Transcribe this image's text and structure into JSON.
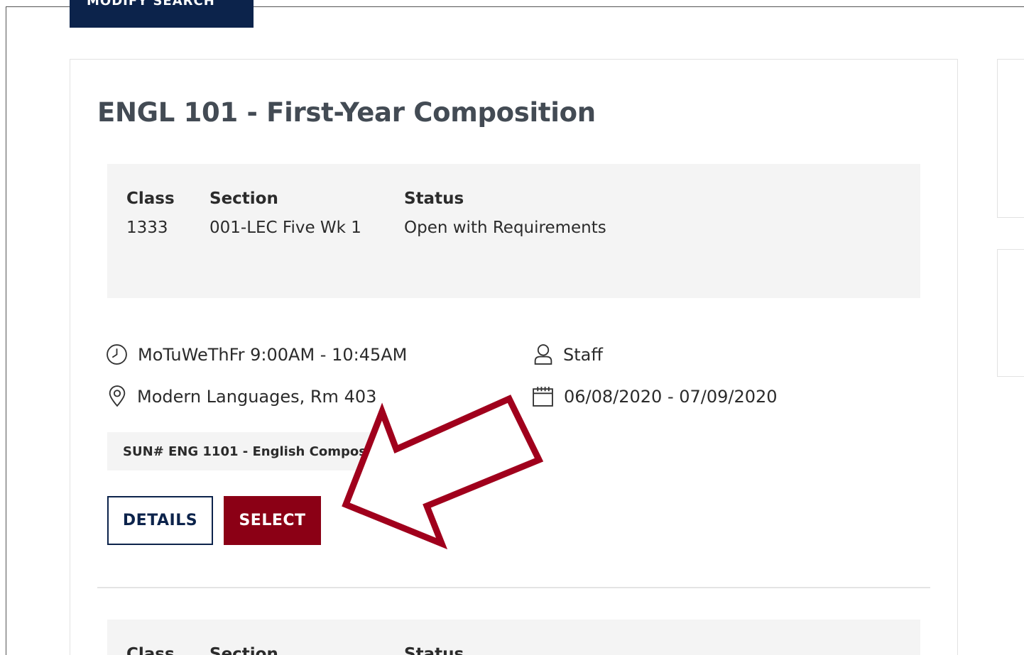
{
  "modify_search": {
    "label": "MODIFY SEARCH"
  },
  "course": {
    "title": "ENGL 101 - First-Year Composition"
  },
  "section1": {
    "headers": {
      "class": "Class",
      "section": "Section",
      "status": "Status"
    },
    "values": {
      "class": "1333",
      "section": "001-LEC Five Wk 1",
      "status": "Open with Requirements"
    }
  },
  "meeting": {
    "days_time": "MoTuWeThFr 9:00AM - 10:45AM",
    "instructor": "Staff",
    "location": "Modern Languages, Rm 403",
    "dates": "06/08/2020 - 07/09/2020"
  },
  "tag": {
    "text": "SUN# ENG 1101 - English Composition I"
  },
  "buttons": {
    "details": "DETAILS",
    "select": "SELECT"
  },
  "section2": {
    "headers": {
      "class": "Class",
      "section": "Section",
      "status": "Status"
    }
  },
  "icons": {
    "clock": "clock-icon",
    "location": "map-pin-icon",
    "person": "person-icon",
    "calendar": "calendar-icon",
    "tag": "tag-icon",
    "arrow": "annotation-arrow-icon"
  },
  "colors": {
    "navy": "#0c234b",
    "select_red": "#8b0015",
    "arrow_red": "#a0001c",
    "panel_gray": "#f4f4f4"
  }
}
